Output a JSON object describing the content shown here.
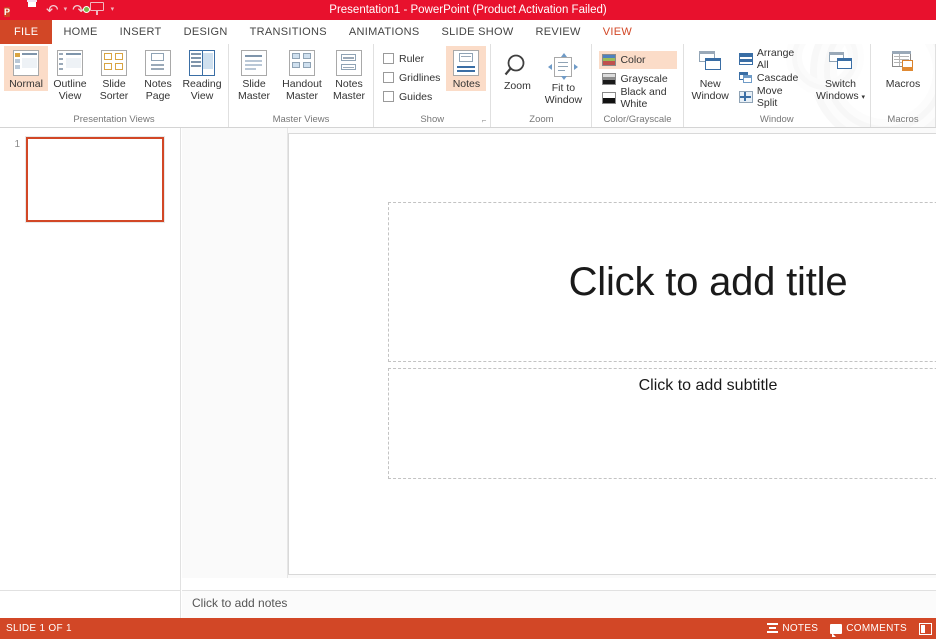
{
  "titlebar": {
    "title": "Presentation1  -  PowerPoint (Product Activation Failed)",
    "qat": [
      {
        "name": "powerpoint-logo",
        "label": "P"
      },
      {
        "name": "save-icon",
        "label": "Save"
      },
      {
        "name": "undo-icon",
        "label": "Undo"
      },
      {
        "name": "redo-icon",
        "label": "Redo"
      },
      {
        "name": "start-presentation-icon",
        "label": "Start From Beginning"
      },
      {
        "name": "customize-qat-icon",
        "label": "Customize Quick Access Toolbar"
      }
    ],
    "bg_color": "#e8112d"
  },
  "tabs": [
    {
      "label": "FILE",
      "active": false,
      "file": true
    },
    {
      "label": "HOME",
      "active": false
    },
    {
      "label": "INSERT",
      "active": false
    },
    {
      "label": "DESIGN",
      "active": false
    },
    {
      "label": "TRANSITIONS",
      "active": false
    },
    {
      "label": "ANIMATIONS",
      "active": false
    },
    {
      "label": "SLIDE SHOW",
      "active": false
    },
    {
      "label": "REVIEW",
      "active": false
    },
    {
      "label": "VIEW",
      "active": true
    }
  ],
  "ribbon": {
    "accent_color": "#d24726",
    "selected_highlight": "#fbdcc8",
    "groups": {
      "presentation_views": {
        "label": "Presentation Views",
        "buttons": [
          {
            "label_line1": "Normal",
            "label_line2": "",
            "selected": true
          },
          {
            "label_line1": "Outline",
            "label_line2": "View",
            "selected": false
          },
          {
            "label_line1": "Slide",
            "label_line2": "Sorter",
            "selected": false
          },
          {
            "label_line1": "Notes",
            "label_line2": "Page",
            "selected": false
          },
          {
            "label_line1": "Reading",
            "label_line2": "View",
            "selected": false
          }
        ]
      },
      "master_views": {
        "label": "Master Views",
        "buttons": [
          {
            "label_line1": "Slide",
            "label_line2": "Master"
          },
          {
            "label_line1": "Handout",
            "label_line2": "Master"
          },
          {
            "label_line1": "Notes",
            "label_line2": "Master"
          }
        ]
      },
      "show": {
        "label": "Show",
        "checkboxes": [
          {
            "label": "Ruler",
            "checked": false
          },
          {
            "label": "Gridlines",
            "checked": false
          },
          {
            "label": "Guides",
            "checked": false
          }
        ],
        "notes_button": {
          "label": "Notes",
          "selected": true
        },
        "dialog_launcher": "⌐"
      },
      "zoom": {
        "label": "Zoom",
        "buttons": [
          {
            "label_line1": "Zoom",
            "label_line2": ""
          },
          {
            "label_line1": "Fit to",
            "label_line2": "Window"
          }
        ]
      },
      "color_grayscale": {
        "label": "Color/Grayscale",
        "options": [
          {
            "label": "Color",
            "selected": true
          },
          {
            "label": "Grayscale",
            "selected": false
          },
          {
            "label": "Black and White",
            "selected": false
          }
        ]
      },
      "window": {
        "label": "Window",
        "new_window": {
          "label_line1": "New",
          "label_line2": "Window"
        },
        "items": [
          {
            "label": "Arrange All"
          },
          {
            "label": "Cascade"
          },
          {
            "label": "Move Split"
          }
        ],
        "switch_windows": {
          "label_line1": "Switch",
          "label_line2": "Windows",
          "caret": "▾"
        }
      },
      "macros": {
        "label": "Macros",
        "button": {
          "label_line1": "Macros",
          "label_line2": ""
        }
      }
    }
  },
  "workspace": {
    "thumbnail": {
      "number": "1"
    },
    "slide": {
      "title_placeholder": "Click to add title",
      "subtitle_placeholder": "Click to add subtitle"
    },
    "notes_pane": {
      "placeholder": "Click to add notes"
    }
  },
  "statusbar": {
    "slide_count": "SLIDE 1 OF 1",
    "notes_label": "NOTES",
    "comments_label": "COMMENTS",
    "bg_color": "#d24726"
  }
}
